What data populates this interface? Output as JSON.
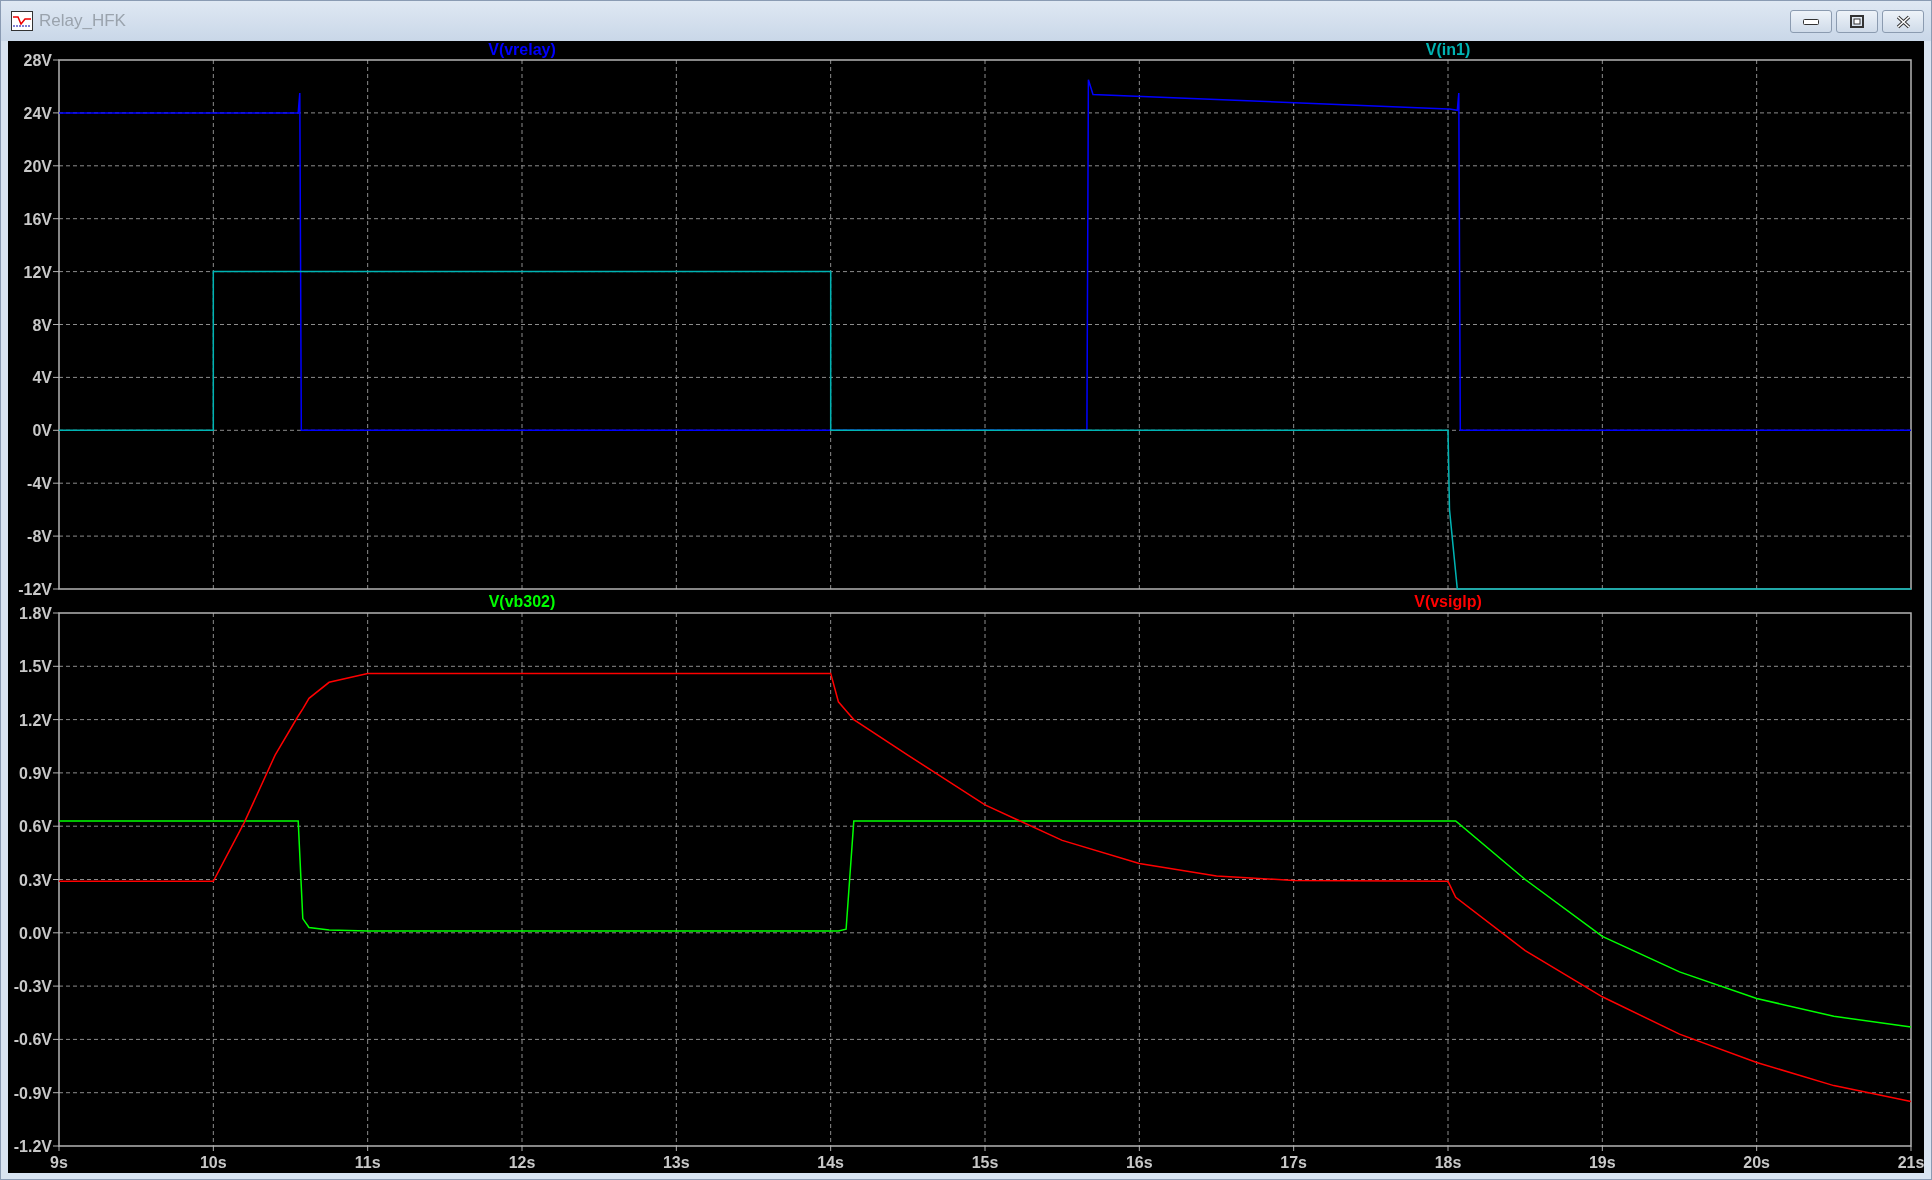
{
  "window": {
    "title": "Relay_HFK"
  },
  "panes": [
    {
      "chart_data": {
        "type": "line",
        "grid": true,
        "xlim": [
          9,
          21
        ],
        "ylim": [
          -12,
          28
        ],
        "yticks": [
          {
            "value": -12,
            "label": "-12V"
          },
          {
            "value": -8,
            "label": "-8V"
          },
          {
            "value": -4,
            "label": "-4V"
          },
          {
            "value": 0,
            "label": "0V"
          },
          {
            "value": 4,
            "label": "4V"
          },
          {
            "value": 8,
            "label": "8V"
          },
          {
            "value": 12,
            "label": "12V"
          },
          {
            "value": 16,
            "label": "16V"
          },
          {
            "value": 20,
            "label": "20V"
          },
          {
            "value": 24,
            "label": "24V"
          },
          {
            "value": 28,
            "label": "28V"
          }
        ],
        "x": [
          9,
          10,
          10,
          10.55,
          10.56,
          10.57,
          14,
          14,
          15.66,
          15.67,
          15.7,
          18,
          18.01,
          18.06,
          18.07,
          18.08,
          21
        ],
        "series": [
          {
            "name": "V(vrelay)",
            "color": "#0000ff",
            "values": [
              24,
              24,
              24,
              24,
              25.5,
              0,
              0,
              0,
              0,
              26.5,
              25.4,
              24.3,
              24.3,
              24.2,
              25.5,
              0,
              0
            ]
          },
          {
            "name": "V(in1)",
            "color": "#00b4b4",
            "values": [
              0,
              0,
              12,
              12,
              12,
              12,
              12,
              0,
              0,
              0,
              0,
              0,
              -6,
              -12,
              -12,
              -12,
              -12
            ]
          }
        ]
      }
    },
    {
      "chart_data": {
        "type": "line",
        "grid": true,
        "xlim": [
          9,
          21
        ],
        "ylim": [
          -1.2,
          1.8
        ],
        "xticks": [
          {
            "value": 9,
            "label": "9s"
          },
          {
            "value": 10,
            "label": "10s"
          },
          {
            "value": 11,
            "label": "11s"
          },
          {
            "value": 12,
            "label": "12s"
          },
          {
            "value": 13,
            "label": "13s"
          },
          {
            "value": 14,
            "label": "14s"
          },
          {
            "value": 15,
            "label": "15s"
          },
          {
            "value": 16,
            "label": "16s"
          },
          {
            "value": 17,
            "label": "17s"
          },
          {
            "value": 18,
            "label": "18s"
          },
          {
            "value": 19,
            "label": "19s"
          },
          {
            "value": 20,
            "label": "20s"
          },
          {
            "value": 21,
            "label": "21s"
          }
        ],
        "yticks": [
          {
            "value": -1.2,
            "label": "-1.2V"
          },
          {
            "value": -0.9,
            "label": "-0.9V"
          },
          {
            "value": -0.6,
            "label": "-0.6V"
          },
          {
            "value": -0.3,
            "label": "-0.3V"
          },
          {
            "value": 0,
            "label": "0.0V"
          },
          {
            "value": 0.3,
            "label": "0.3V"
          },
          {
            "value": 0.6,
            "label": "0.6V"
          },
          {
            "value": 0.9,
            "label": "0.9V"
          },
          {
            "value": 1.2,
            "label": "1.2V"
          },
          {
            "value": 1.5,
            "label": "1.5V"
          },
          {
            "value": 1.8,
            "label": "1.8V"
          }
        ],
        "x": [
          9,
          10,
          10.2,
          10.4,
          10.55,
          10.58,
          10.62,
          10.75,
          11,
          14,
          14.05,
          14.1,
          14.15,
          14.5,
          15,
          15.5,
          16,
          16.5,
          17,
          18,
          18.05,
          18.5,
          19,
          19.5,
          20,
          20.5,
          21
        ],
        "series": [
          {
            "name": "V(vb302)",
            "color": "#00ff00",
            "values": [
              0.63,
              0.63,
              0.63,
              0.63,
              0.63,
              0.08,
              0.03,
              0.015,
              0.01,
              0.01,
              0.01,
              0.02,
              0.63,
              0.63,
              0.63,
              0.63,
              0.63,
              0.63,
              0.63,
              0.63,
              0.63,
              0.3,
              -0.02,
              -0.22,
              -0.37,
              -0.47,
              -0.53
            ]
          },
          {
            "name": "V(vsiglp)",
            "color": "#ff0000",
            "values": [
              0.29,
              0.29,
              0.62,
              1.0,
              1.22,
              1.26,
              1.32,
              1.41,
              1.46,
              1.46,
              1.3,
              1.25,
              1.2,
              1.0,
              0.72,
              0.52,
              0.39,
              0.32,
              0.295,
              0.29,
              0.2,
              -0.1,
              -0.36,
              -0.57,
              -0.73,
              -0.86,
              -0.95
            ]
          }
        ]
      }
    }
  ]
}
